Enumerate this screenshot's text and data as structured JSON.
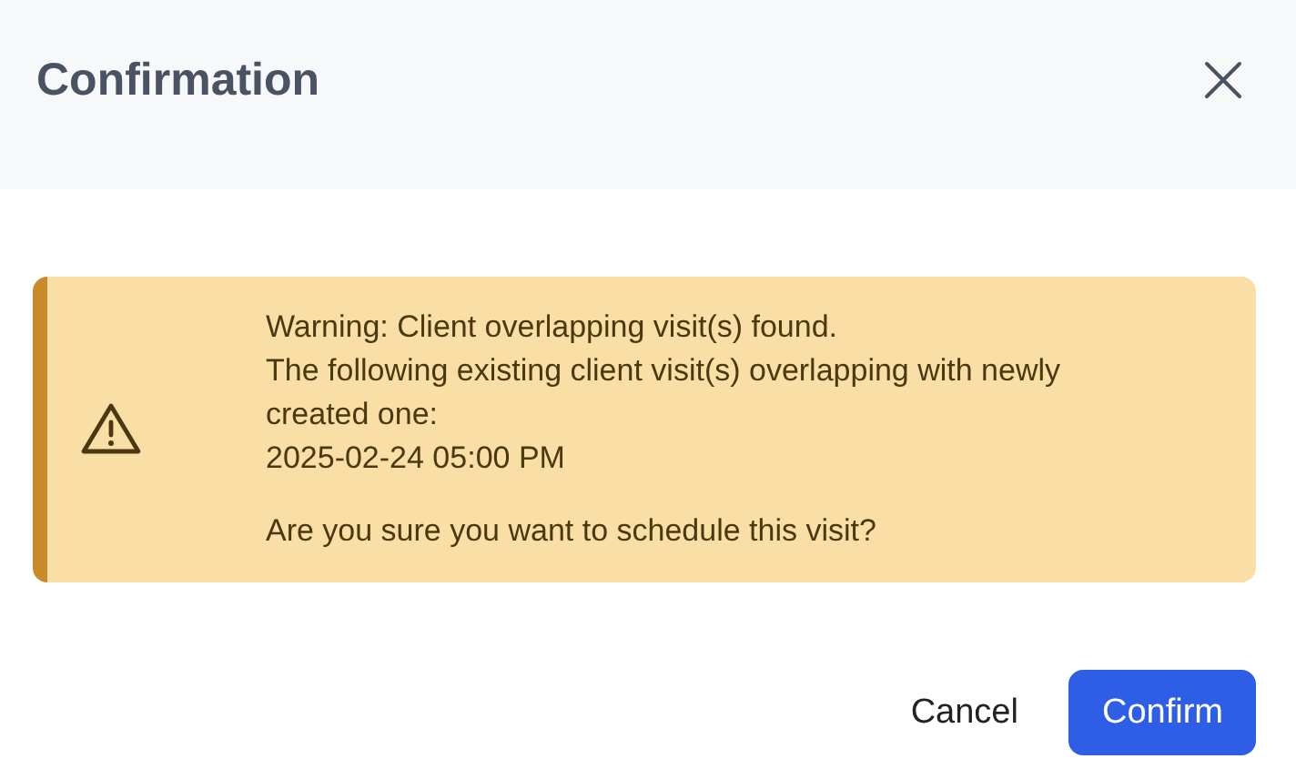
{
  "dialog": {
    "title": "Confirmation"
  },
  "alert": {
    "kind": "warning",
    "lines": [
      "Warning: Client overlapping visit(s) found.",
      "The following existing client visit(s) overlapping with newly created one:",
      "2025-02-24 05:00 PM"
    ],
    "question": "Are you sure you want to schedule this visit?"
  },
  "buttons": [
    {
      "label": "Cancel",
      "kind": "secondary"
    },
    {
      "label": "Confirm",
      "kind": "primary"
    }
  ]
}
